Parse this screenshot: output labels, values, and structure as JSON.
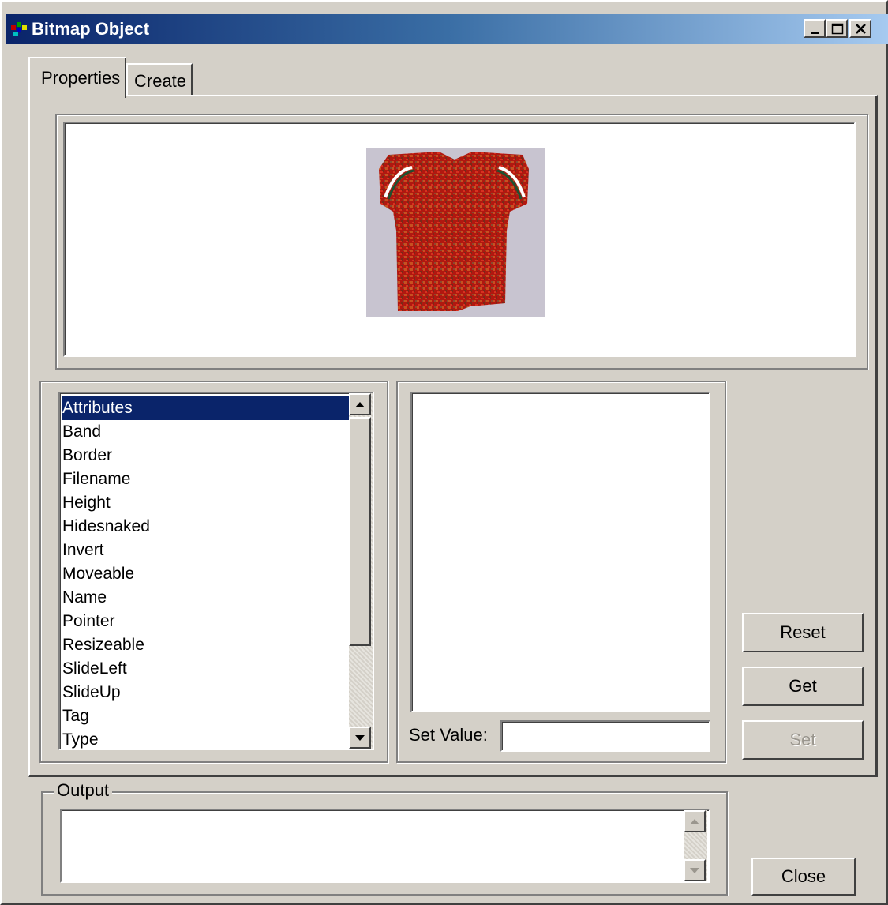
{
  "window": {
    "title": "Bitmap Object"
  },
  "tabs": [
    {
      "label": "Properties",
      "active": true
    },
    {
      "label": "Create",
      "active": false
    }
  ],
  "properties_list": {
    "items": [
      "Attributes",
      "Band",
      "Border",
      "Filename",
      "Height",
      "Hidesnaked",
      "Invert",
      "Moveable",
      "Name",
      "Pointer",
      "Resizeable",
      "SlideLeft",
      "SlideUp",
      "Tag",
      "Type"
    ],
    "selected": "Attributes"
  },
  "value_panel": {
    "set_value_label": "Set Value:",
    "set_value": ""
  },
  "buttons": {
    "reset": "Reset",
    "get": "Get",
    "set": "Set",
    "close": "Close"
  },
  "output": {
    "label": "Output",
    "text": ""
  },
  "colors": {
    "title_start": "#0a246a",
    "title_end": "#a6caf0",
    "face": "#d4d0c8",
    "selection": "#0a246a",
    "preview_bg": "#c8c4d0"
  }
}
